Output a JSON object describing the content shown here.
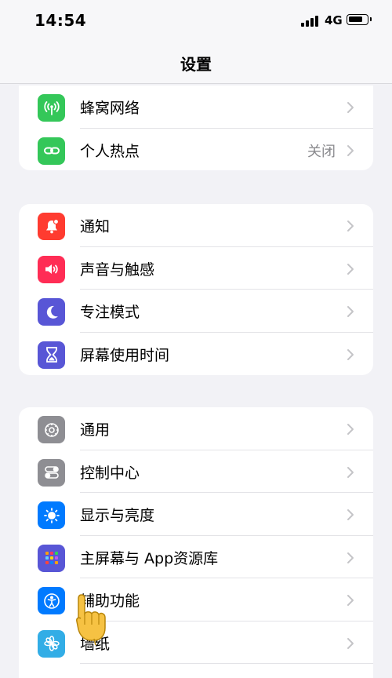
{
  "status_bar": {
    "time": "14:54",
    "network": "4G"
  },
  "nav": {
    "title": "设置"
  },
  "groups": [
    {
      "rows": [
        {
          "label": "蜂窝网络",
          "value": ""
        },
        {
          "label": "个人热点",
          "value": "关闭"
        }
      ]
    },
    {
      "rows": [
        {
          "label": "通知",
          "value": ""
        },
        {
          "label": "声音与触感",
          "value": ""
        },
        {
          "label": "专注模式",
          "value": ""
        },
        {
          "label": "屏幕使用时间",
          "value": ""
        }
      ]
    },
    {
      "rows": [
        {
          "label": "通用",
          "value": ""
        },
        {
          "label": "控制中心",
          "value": ""
        },
        {
          "label": "显示与亮度",
          "value": ""
        },
        {
          "label": "主屏幕与 App资源库",
          "value": ""
        },
        {
          "label": "辅助功能",
          "value": ""
        },
        {
          "label": "墙纸",
          "value": ""
        }
      ]
    }
  ],
  "icons": {
    "cellular": "#34c759",
    "hotspot": "#34c759",
    "notifications": "#ff3b30",
    "sounds": "#ff2d55",
    "focus": "#5856d6",
    "screen_time": "#5856d6",
    "general": "#8e8e93",
    "control_center": "#8e8e93",
    "display": "#007aff",
    "home_screen": "#5856d6",
    "accessibility": "#007aff",
    "wallpaper": "#32ade6"
  }
}
